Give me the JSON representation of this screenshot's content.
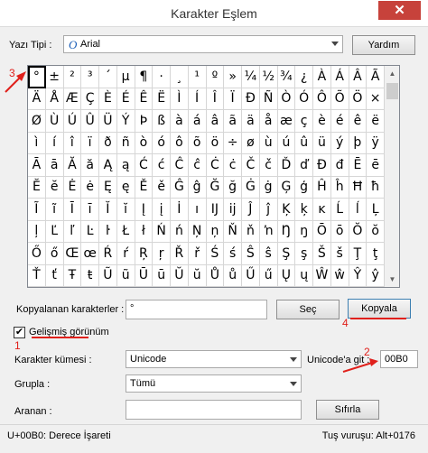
{
  "window": {
    "title": "Karakter Eşlem",
    "close_glyph": "✕"
  },
  "font_row": {
    "label": "Yazı Tipi :",
    "font_icon": "O",
    "font_value": "Arial",
    "help_button": "Yardım"
  },
  "grid": {
    "rows": [
      [
        "°",
        "±",
        "²",
        "³",
        "´",
        "µ",
        "¶",
        "·",
        "¸",
        "¹",
        "º",
        "»",
        "¼",
        "½",
        "¾",
        "¿",
        "À",
        "Á",
        "Â",
        "Ã"
      ],
      [
        "Ä",
        "Å",
        "Æ",
        "Ç",
        "È",
        "É",
        "Ê",
        "Ë",
        "Ì",
        "Í",
        "Î",
        "Ï",
        "Ð",
        "Ñ",
        "Ò",
        "Ó",
        "Ô",
        "Õ",
        "Ö",
        "×"
      ],
      [
        "Ø",
        "Ù",
        "Ú",
        "Û",
        "Ü",
        "Ý",
        "Þ",
        "ß",
        "à",
        "á",
        "â",
        "ã",
        "ä",
        "å",
        "æ",
        "ç",
        "è",
        "é",
        "ê",
        "ë"
      ],
      [
        "ì",
        "í",
        "î",
        "ï",
        "ð",
        "ñ",
        "ò",
        "ó",
        "ô",
        "õ",
        "ö",
        "÷",
        "ø",
        "ù",
        "ú",
        "û",
        "ü",
        "ý",
        "þ",
        "ÿ"
      ],
      [
        "Ā",
        "ā",
        "Ă",
        "ă",
        "Ą",
        "ą",
        "Ć",
        "ć",
        "Ĉ",
        "ĉ",
        "Ċ",
        "ċ",
        "Č",
        "č",
        "Ď",
        "ď",
        "Đ",
        "đ",
        "Ē",
        "ē"
      ],
      [
        "Ĕ",
        "ĕ",
        "Ė",
        "ė",
        "Ę",
        "ę",
        "Ě",
        "ě",
        "Ĝ",
        "ĝ",
        "Ğ",
        "ğ",
        "Ġ",
        "ġ",
        "Ģ",
        "ģ",
        "Ĥ",
        "ĥ",
        "Ħ",
        "ħ"
      ],
      [
        "Ĩ",
        "ĩ",
        "Ī",
        "ī",
        "Ĭ",
        "ĭ",
        "Į",
        "į",
        "İ",
        "ı",
        "Ĳ",
        "ĳ",
        "Ĵ",
        "ĵ",
        "Ķ",
        "ķ",
        "ĸ",
        "Ĺ",
        "ĺ",
        "Ļ"
      ],
      [
        "ļ",
        "Ľ",
        "ľ",
        "Ŀ",
        "ŀ",
        "Ł",
        "ł",
        "Ń",
        "ń",
        "Ņ",
        "ņ",
        "Ň",
        "ň",
        "ŉ",
        "Ŋ",
        "ŋ",
        "Ō",
        "ō",
        "Ŏ",
        "ŏ"
      ],
      [
        "Ő",
        "ő",
        "Œ",
        "œ",
        "Ŕ",
        "ŕ",
        "Ŗ",
        "ŗ",
        "Ř",
        "ř",
        "Ś",
        "ś",
        "Ŝ",
        "ŝ",
        "Ş",
        "ş",
        "Š",
        "š",
        "Ţ",
        "ţ"
      ],
      [
        "Ť",
        "ť",
        "Ŧ",
        "ŧ",
        "Ũ",
        "ũ",
        "Ū",
        "ū",
        "Ŭ",
        "ŭ",
        "Ů",
        "ů",
        "Ű",
        "ű",
        "Ų",
        "ų",
        "Ŵ",
        "ŵ",
        "Ŷ",
        "ŷ"
      ]
    ],
    "selected": "°"
  },
  "copy_row": {
    "label": "Kopyalanan karakterler :",
    "value": "°",
    "select_button": "Seç",
    "copy_button": "Kopyala"
  },
  "advanced": {
    "checkbox_label": "Gelişmiş görünüm",
    "checked": true,
    "check_glyph": "✔"
  },
  "charset": {
    "label": "Karakter kümesi :",
    "value": "Unicode"
  },
  "goto_unicode": {
    "label": "Unicode'a git :",
    "value": "00B0"
  },
  "group": {
    "label": "Grupla :",
    "value": "Tümü"
  },
  "search": {
    "label": "Aranan :",
    "value": "",
    "clear_button": "Sıfırla"
  },
  "status": {
    "left": "U+00B0: Derece İşareti",
    "right": "Tuş vuruşu: Alt+0176"
  },
  "annotations": {
    "n1": "1",
    "n2": "2",
    "n3": "3",
    "n4": "4",
    "color": "#e0201b"
  }
}
